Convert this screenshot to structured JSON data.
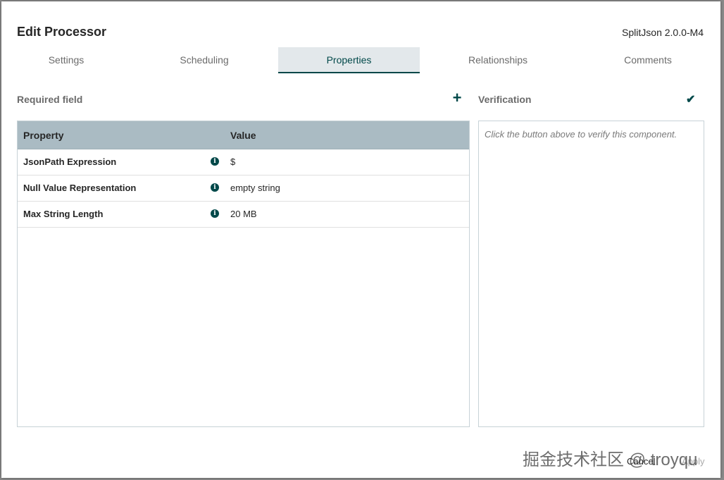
{
  "dialog": {
    "title": "Edit Processor",
    "version": "SplitJson 2.0.0-M4"
  },
  "tabs": [
    {
      "label": "Settings",
      "active": false
    },
    {
      "label": "Scheduling",
      "active": false
    },
    {
      "label": "Properties",
      "active": true
    },
    {
      "label": "Relationships",
      "active": false
    },
    {
      "label": "Comments",
      "active": false
    }
  ],
  "properties": {
    "required_label": "Required field",
    "add_icon": "plus-icon",
    "columns": {
      "property": "Property",
      "value": "Value"
    },
    "rows": [
      {
        "name": "JsonPath Expression",
        "info_icon": "info-icon",
        "value": "$"
      },
      {
        "name": "Null Value Representation",
        "info_icon": "info-icon",
        "value": "empty string"
      },
      {
        "name": "Max String Length",
        "info_icon": "info-icon",
        "value": "20 MB"
      }
    ]
  },
  "verification": {
    "label": "Verification",
    "check_icon": "checkmark-icon",
    "message": "Click the button above to verify this component."
  },
  "footer": {
    "cancel_label": "Cancel",
    "apply_label": "Apply"
  },
  "watermark": "掘金技术社区 @ troyqu",
  "colors": {
    "accent": "#004849",
    "table_header": "#aabbc3",
    "active_tab_bg": "#e3e8eb"
  }
}
